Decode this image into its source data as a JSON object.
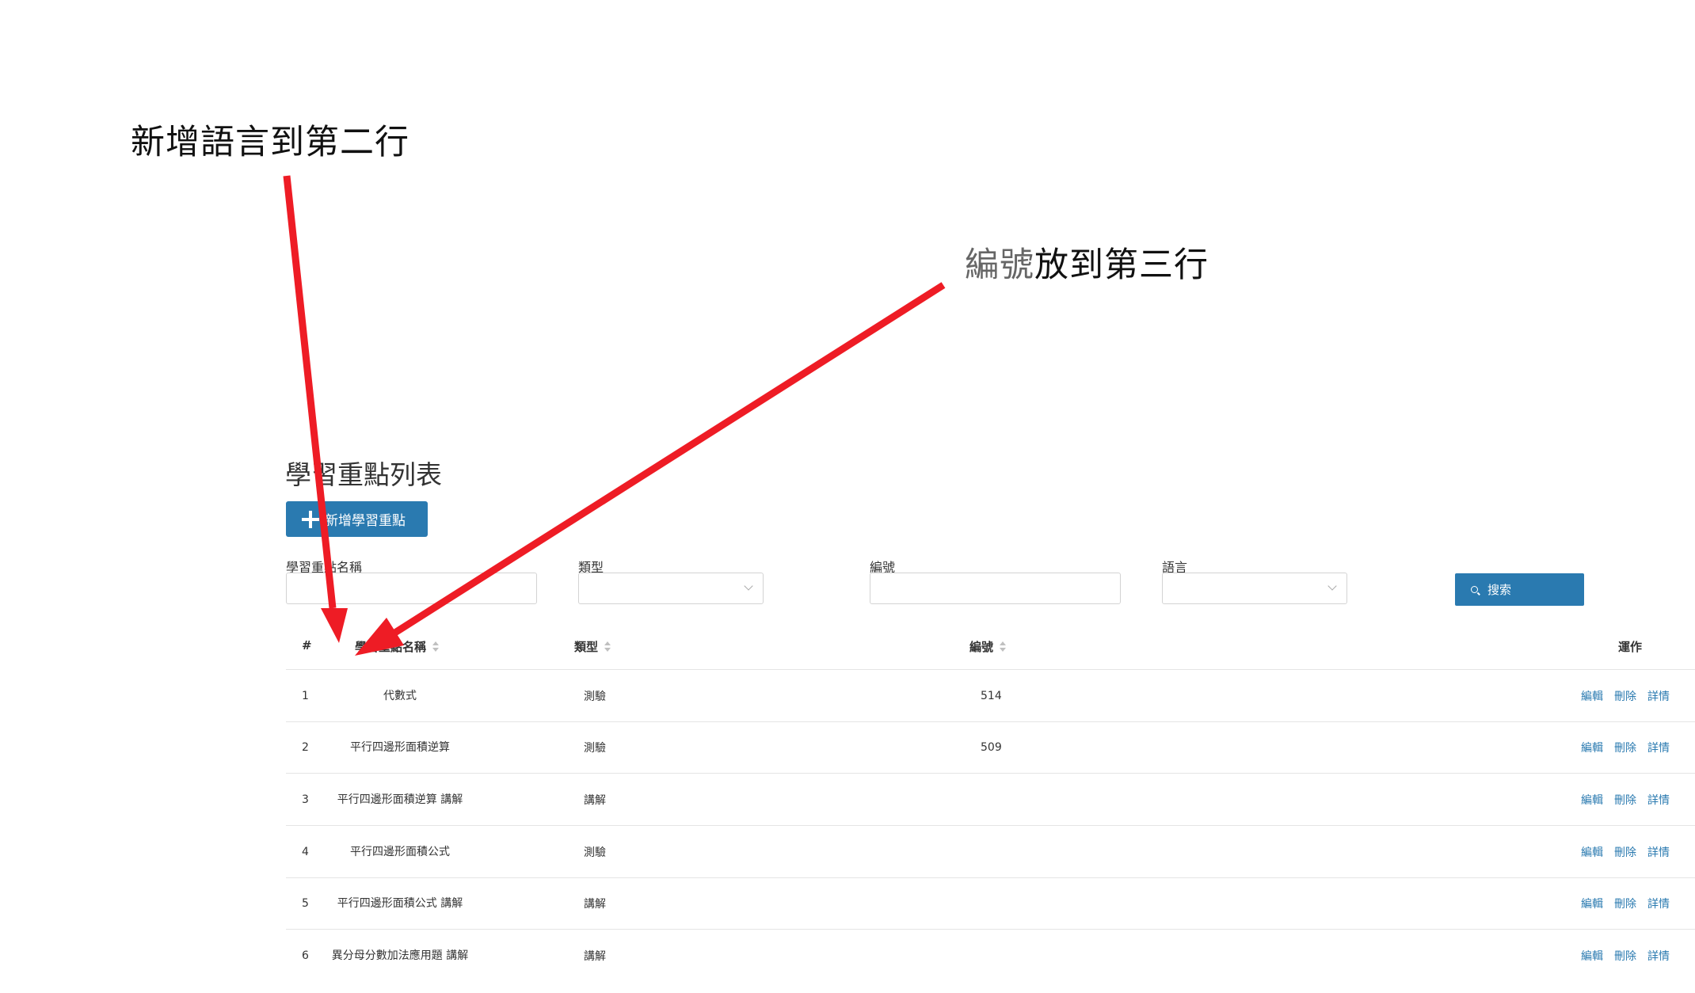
{
  "annotations": {
    "note1": "新增語言到第二行",
    "note2_grey": "編號",
    "note2_rest": "放到第三行"
  },
  "page": {
    "title": "學習重點列表",
    "add_button": "新增學習重點"
  },
  "filters": {
    "name_label": "學習重點名稱",
    "type_label": "類型",
    "code_label": "編號",
    "lang_label": "語言",
    "search_button": "搜索"
  },
  "table": {
    "headers": {
      "index": "#",
      "name": "學習重點名稱",
      "type": "類型",
      "code": "編號",
      "ops": "運作"
    },
    "rows": [
      {
        "idx": "1",
        "name": "代數式",
        "type": "測驗",
        "code": "514"
      },
      {
        "idx": "2",
        "name": "平行四邊形面積逆算",
        "type": "測驗",
        "code": "509"
      },
      {
        "idx": "3",
        "name": "平行四邊形面積逆算 講解",
        "type": "講解",
        "code": ""
      },
      {
        "idx": "4",
        "name": "平行四邊形面積公式",
        "type": "測驗",
        "code": ""
      },
      {
        "idx": "5",
        "name": "平行四邊形面積公式 講解",
        "type": "講解",
        "code": ""
      },
      {
        "idx": "6",
        "name": "異分母分數加法應用題 講解",
        "type": "講解",
        "code": ""
      }
    ],
    "actions": {
      "edit": "編輯",
      "delete": "刪除",
      "detail": "詳情"
    }
  },
  "colors": {
    "primary": "#2a7ab0",
    "arrow": "#ee1c25"
  }
}
